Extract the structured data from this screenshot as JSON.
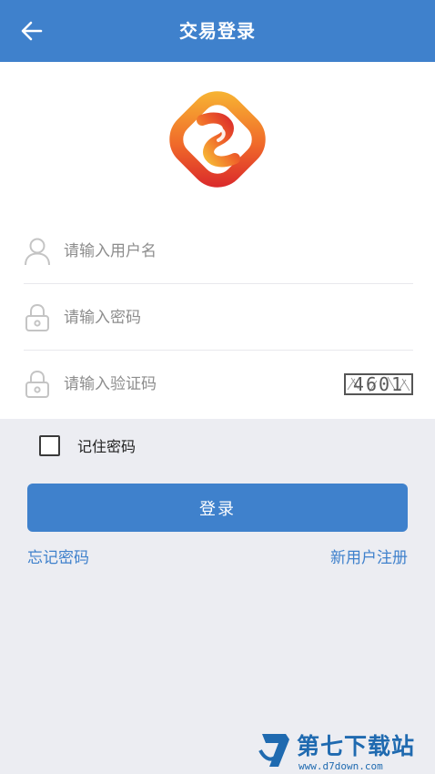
{
  "header": {
    "title": "交易登录",
    "back_icon": "arrow-left-icon"
  },
  "logo": {
    "icon": "brand-logo"
  },
  "form": {
    "username_placeholder": "请输入用户名",
    "password_placeholder": "请输入密码",
    "captcha_placeholder": "请输入验证码",
    "captcha_code": "4601",
    "remember_label": "记住密码",
    "remember_checked": false,
    "login_label": "登录"
  },
  "links": {
    "forgot_password": "忘记密码",
    "register": "新用户注册"
  },
  "watermark": {
    "name": "第七下载站",
    "url": "www.d7down.com"
  },
  "colors": {
    "primary": "#3f81cc",
    "background": "#ecedf2",
    "placeholder": "#8d8d8d"
  }
}
